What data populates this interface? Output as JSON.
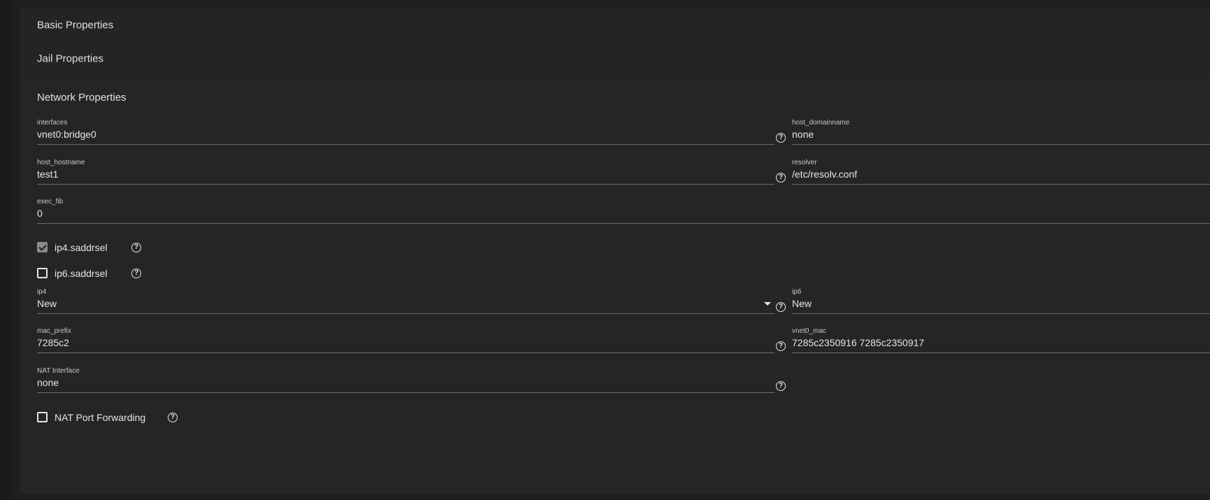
{
  "sections": {
    "basic": "Basic Properties",
    "jail": "Jail Properties",
    "network": "Network Properties"
  },
  "fields": {
    "interfaces": {
      "label": "interfaces",
      "value": "vnet0:bridge0"
    },
    "host_domainname": {
      "label": "host_domainname",
      "value": "none"
    },
    "host_hostname": {
      "label": "host_hostname",
      "value": "test1"
    },
    "resolver": {
      "label": "resolver",
      "value": "/etc/resolv.conf"
    },
    "exec_fib": {
      "label": "exec_fib",
      "value": "0"
    },
    "ip4": {
      "label": "ip4",
      "value": "New"
    },
    "ip6": {
      "label": "ip6",
      "value": "New"
    },
    "mac_prefix": {
      "label": "mac_prefix",
      "value": "7285c2"
    },
    "vnet0_mac": {
      "label": "vnet0_mac",
      "value": "7285c2350916 7285c2350917"
    },
    "nat_interface": {
      "label": "NAT Interface",
      "value": "none"
    }
  },
  "checkboxes": {
    "ip4_saddrsel": {
      "label": "ip4.saddrsel",
      "checked": true
    },
    "ip6_saddrsel": {
      "label": "ip6.saddrsel",
      "checked": false
    },
    "nat_port_forwarding": {
      "label": "NAT Port Forwarding",
      "checked": false
    }
  },
  "icons": {
    "help": "help-circle-icon",
    "help_glyph": "?",
    "dropdown": "chevron-down-icon"
  }
}
